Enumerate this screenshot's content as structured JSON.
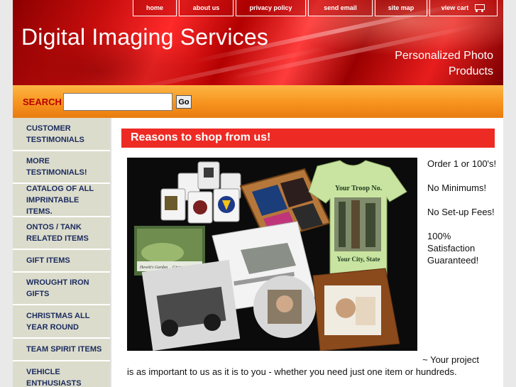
{
  "header": {
    "site_title": "Digital Imaging Services",
    "tagline": "Personalized Photo Products"
  },
  "topnav": {
    "home": "home",
    "about": "about us",
    "privacy": "privacy policy",
    "email": "send email",
    "sitemap": "site map",
    "cart": "view cart",
    "cart_icon": "shopping-cart-icon"
  },
  "search": {
    "label": "SEARCH",
    "value": "",
    "placeholder": "",
    "go_label": "Go"
  },
  "sidebar": {
    "items": [
      {
        "label": "CUSTOMER TESTIMONIALS"
      },
      {
        "label": "MORE TESTIMONIALS!"
      },
      {
        "label": "CATALOG OF ALL IMPRINTABLE ITEMS."
      },
      {
        "label": "ONTOS / TANK RELATED ITEMS"
      },
      {
        "label": "GIFT ITEMS"
      },
      {
        "label": "WROUGHT IRON GIFTS"
      },
      {
        "label": "CHRISTMAS ALL YEAR ROUND"
      },
      {
        "label": "TEAM SPIRIT ITEMS"
      },
      {
        "label": "VEHICLE ENTHUSIASTS"
      }
    ]
  },
  "main": {
    "heading": "Reasons to shop from us!",
    "photo": {
      "shirt_line1": "Your Troop No.",
      "shirt_line2": "Your City, State",
      "plate_caption": "Hewitt's Garden",
      "plate_caption2": "Giverny, France"
    },
    "reasons": [
      "Order 1 or 100's!",
      "No Minimums!",
      "No Set-up Fees!",
      "100% Satisfaction Guaranteed!"
    ],
    "tagline_line1": "~ Your project",
    "tagline_line2": "is as important to us as it is to you - whether you need just one item or hundreds."
  },
  "colors": {
    "header_red": "#d41414",
    "search_orange": "#f7931e",
    "heading_red": "#ee2a24",
    "sidebar_bg": "#dcdccc",
    "sidebar_text": "#1a2b5e"
  }
}
